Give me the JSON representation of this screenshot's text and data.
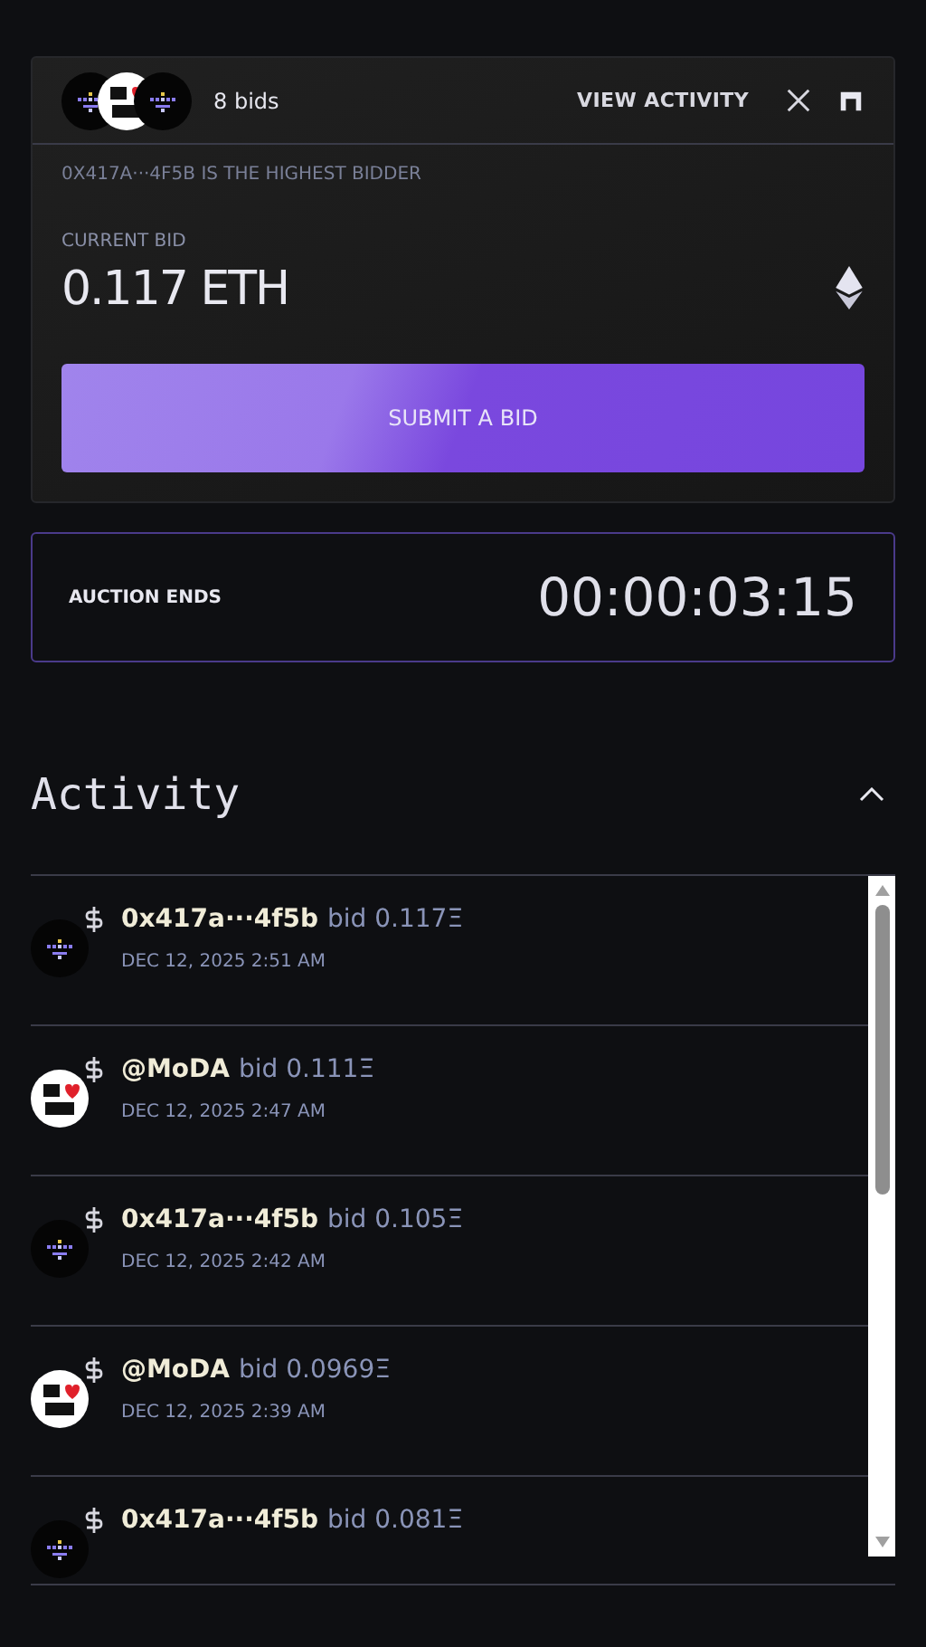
{
  "header": {
    "bidder_avatars": [
      {
        "kind": "pixel"
      },
      {
        "kind": "moda"
      },
      {
        "kind": "pixel"
      }
    ],
    "bids": "8 bids",
    "view_activity": "VIEW ACTIVITY",
    "highest_bidder": "0X417A···4F5B IS THE HIGHEST BIDDER"
  },
  "current_bid": {
    "label": "CURRENT BID",
    "value": "0.117 ETH"
  },
  "submit": "SUBMIT A BID",
  "auction": {
    "label": "AUCTION ENDS",
    "countdown": "00:00:03:15"
  },
  "activity": {
    "title": "Activity",
    "expanded": true,
    "items": [
      {
        "kind": "pixel",
        "name": "0x417a···4f5b",
        "action": "bid 0.117Ξ",
        "date": "DEC 12, 2025 2:51 AM"
      },
      {
        "kind": "moda",
        "name": "@MoDA",
        "action": "bid 0.111Ξ",
        "date": "DEC 12, 2025 2:47 AM"
      },
      {
        "kind": "pixel",
        "name": "0x417a···4f5b",
        "action": "bid 0.105Ξ",
        "date": "DEC 12, 2025 2:42 AM"
      },
      {
        "kind": "moda",
        "name": "@MoDA",
        "action": "bid 0.0969Ξ",
        "date": "DEC 12, 2025 2:39 AM"
      },
      {
        "kind": "pixel",
        "name": "0x417a···4f5b",
        "action": "bid 0.081Ξ"
      }
    ]
  }
}
